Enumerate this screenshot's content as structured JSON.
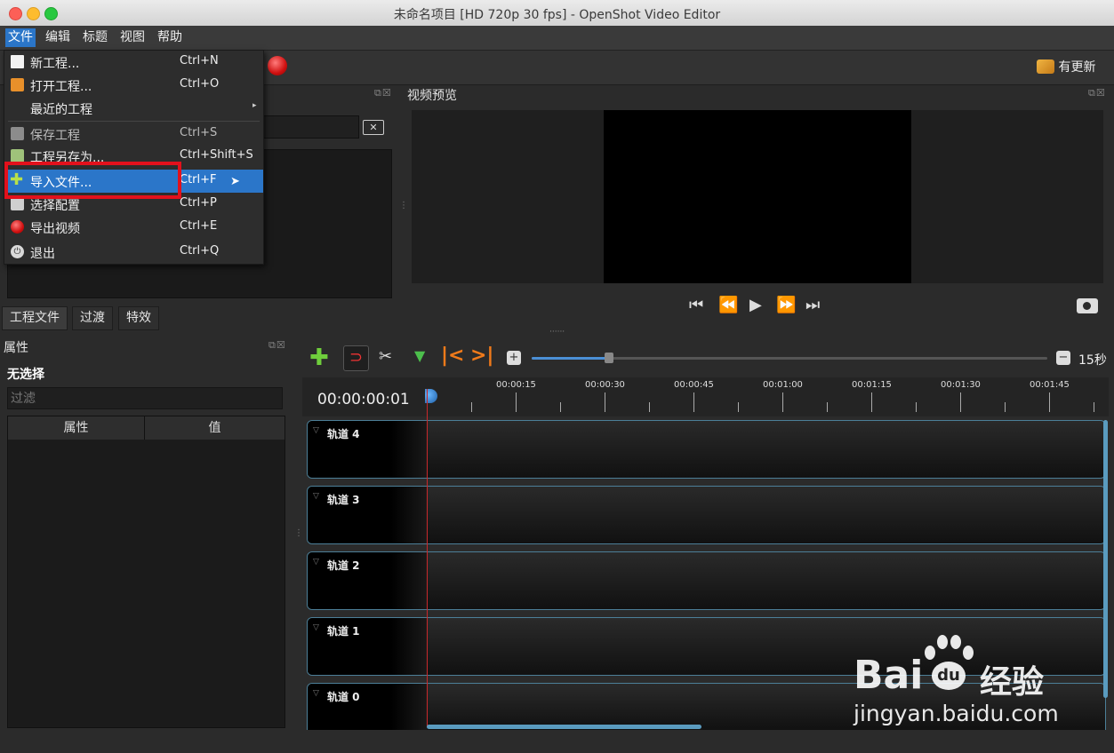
{
  "window": {
    "title": "未命名项目 [HD 720p 30 fps] - OpenShot Video Editor"
  },
  "menubar": {
    "items": [
      "文件",
      "编辑",
      "标题",
      "视图",
      "帮助"
    ]
  },
  "toolbar": {
    "update_label": "有更新"
  },
  "file_menu": {
    "items": [
      {
        "label": "新工程...",
        "shortcut": "Ctrl+N"
      },
      {
        "label": "打开工程...",
        "shortcut": "Ctrl+O"
      },
      {
        "label": "最近的工程",
        "shortcut": ""
      },
      {
        "label": "保存工程",
        "shortcut": "Ctrl+S"
      },
      {
        "label": "工程另存为...",
        "shortcut": "Ctrl+Shift+S"
      },
      {
        "label": "导入文件...",
        "shortcut": "Ctrl+F"
      },
      {
        "label": "选择配置",
        "shortcut": "Ctrl+P"
      },
      {
        "label": "导出视频",
        "shortcut": "Ctrl+E"
      },
      {
        "label": "退出",
        "shortcut": "Ctrl+Q"
      }
    ]
  },
  "preview": {
    "title": "视频预览"
  },
  "tabs": [
    "工程文件",
    "过渡",
    "特效"
  ],
  "properties": {
    "title": "属性",
    "selection": "无选择",
    "filter_placeholder": "过滤",
    "col_property": "属性",
    "col_value": "值"
  },
  "timeline": {
    "timecode": "00:00:00:01",
    "zoom_label": "15秒",
    "ticks": [
      "00:00:15",
      "00:00:30",
      "00:00:45",
      "00:01:00",
      "00:01:15",
      "00:01:30",
      "00:01:45"
    ],
    "tracks": [
      "轨道 4",
      "轨道 3",
      "轨道 2",
      "轨道 1",
      "轨道 0"
    ],
    "zoom_level": 0.15
  },
  "watermark": {
    "brand": "Bai du 经验",
    "url": "jingyan.baidu.com"
  },
  "colors": {
    "menu_highlight": "#2b76c9",
    "annotation_box": "#e2111c",
    "track_border": "#4c7f98",
    "playhead": "#c8282b"
  }
}
